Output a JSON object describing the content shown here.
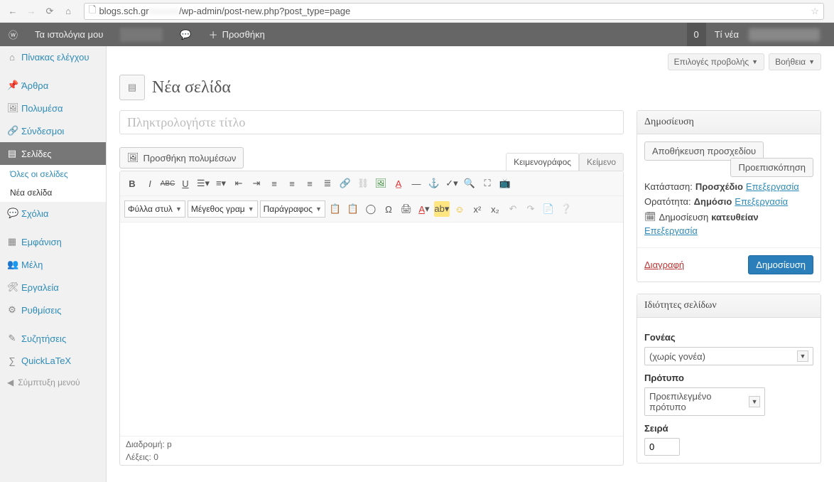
{
  "browser": {
    "url_prefix": "blogs.sch.gr",
    "url_suffix": "/wp-admin/post-new.php?post_type=page"
  },
  "adminbar": {
    "my_blogs": "Τα ιστολόγια μου",
    "new": "Προσθήκη",
    "count": "0",
    "whatsnew": "Τί νέα"
  },
  "sidebar": {
    "dashboard": "Πίνακας ελέγχου",
    "posts": "Άρθρα",
    "media": "Πολυμέσα",
    "links": "Σύνδεσμοι",
    "pages": "Σελίδες",
    "pages_all": "Όλες οι σελίδες",
    "pages_new": "Νέα σελίδα",
    "comments": "Σχόλια",
    "appearance": "Εμφάνιση",
    "users": "Μέλη",
    "tools": "Εργαλεία",
    "settings": "Ρυθμίσεις",
    "discussions": "Συζητήσεις",
    "quicklatex": "QuickLaTeX",
    "collapse": "Σύμπτυξη μενού"
  },
  "screen": {
    "options": "Επιλογές προβολής",
    "help": "Βοήθεια"
  },
  "page_title": "Νέα σελίδα",
  "title_placeholder": "Πληκτρολογήστε τίτλο",
  "media_button": "Προσθήκη πολυμέσων",
  "tabs": {
    "visual": "Κειμενογράφος",
    "text": "Κείμενο"
  },
  "toolbar": {
    "styles": "Φύλλα στυλ",
    "fontsize": "Μέγεθος γραμ",
    "paragraph": "Παράγραφος"
  },
  "status_path": "Διαδρομή: p",
  "status_words": "Λέξεις: 0",
  "publish": {
    "title": "Δημοσίευση",
    "save_draft": "Αποθήκευση προσχεδίου",
    "preview": "Προεπισκόπηση",
    "status_label": "Κατάσταση:",
    "status_value": "Προσχέδιο",
    "edit": "Επεξεργασία",
    "visibility_label": "Ορατότητα:",
    "visibility_value": "Δημόσιο",
    "publish_label": "Δημοσίευση",
    "publish_value": "κατευθείαν",
    "trash": "Διαγραφή",
    "publish_btn": "Δημοσίευση"
  },
  "attrs": {
    "title": "Ιδιότητες σελίδων",
    "parent_label": "Γονέας",
    "parent_value": "(χωρίς γονέα)",
    "template_label": "Πρότυπο",
    "template_value": "Προεπιλεγμένο πρότυπο",
    "order_label": "Σειρά",
    "order_value": "0"
  }
}
